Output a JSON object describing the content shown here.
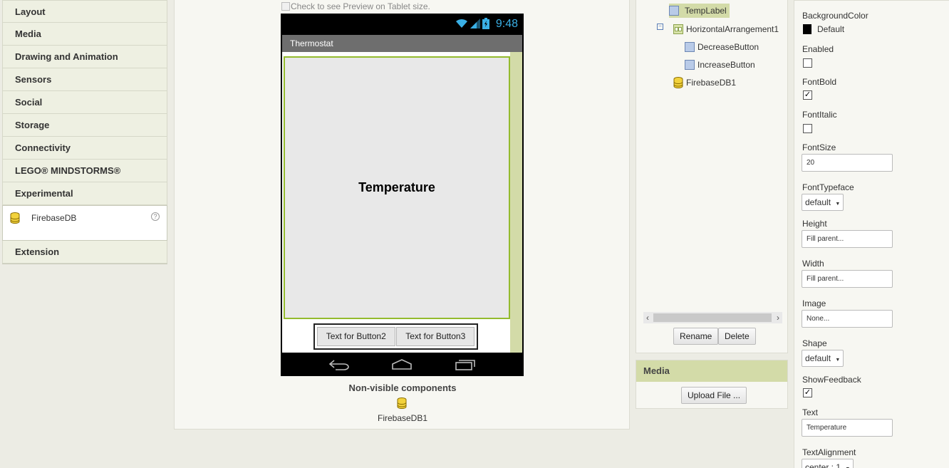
{
  "palette": {
    "categories": [
      "Layout",
      "Media",
      "Drawing and Animation",
      "Sensors",
      "Social",
      "Storage",
      "Connectivity",
      "LEGO® MINDSTORMS®",
      "Experimental"
    ],
    "open_item": {
      "label": "FirebaseDB",
      "icon": "database-icon",
      "help": "?"
    },
    "extension": "Extension"
  },
  "viewer": {
    "tablet_check_label": "Check to see Preview on Tablet size.",
    "clock": "9:48",
    "app_title": "Thermostat",
    "temp_label": "Temperature",
    "button2": "Text for Button2",
    "button3": "Text for Button3",
    "nonvisible_title": "Non-visible components",
    "nonvisible_item": "FirebaseDB1"
  },
  "components": {
    "tree": {
      "templabel": "TempLabel",
      "harr": "HorizontalArrangement1",
      "decrease": "DecreaseButton",
      "increase": "IncreaseButton",
      "firebase": "FirebaseDB1"
    },
    "rename": "Rename",
    "delete": "Delete"
  },
  "media": {
    "title": "Media",
    "upload": "Upload File ..."
  },
  "properties": {
    "bg_label": "BackgroundColor",
    "bg_value": "Default",
    "enabled_label": "Enabled",
    "fontbold_label": "FontBold",
    "fontitalic_label": "FontItalic",
    "fontsize_label": "FontSize",
    "fontsize_value": "20",
    "typeface_label": "FontTypeface",
    "typeface_value": "default",
    "height_label": "Height",
    "height_value": "Fill parent...",
    "width_label": "Width",
    "width_value": "Fill parent...",
    "image_label": "Image",
    "image_value": "None...",
    "shape_label": "Shape",
    "shape_value": "default",
    "showfeedback_label": "ShowFeedback",
    "text_label": "Text",
    "text_value": "Temperature",
    "textalign_label": "TextAlignment",
    "textalign_value": "center : 1"
  },
  "colors": {
    "accent": "#d3dba8",
    "selection_border": "#94bb2e",
    "clock": "#3ab0e6"
  }
}
